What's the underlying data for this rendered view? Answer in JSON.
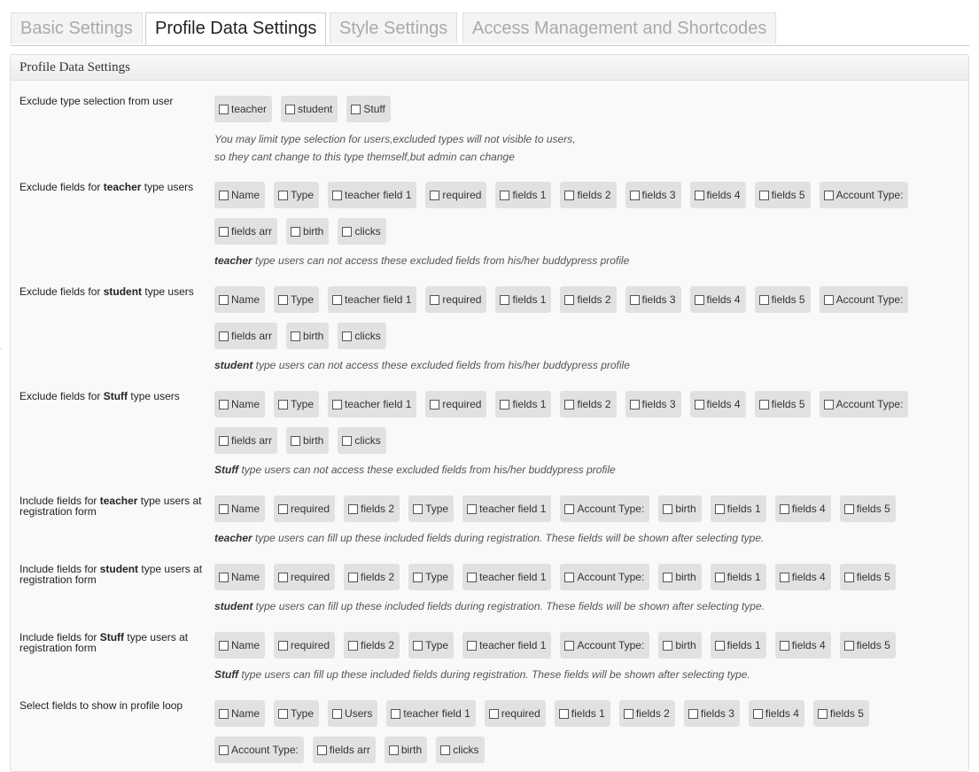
{
  "tabs": [
    {
      "label": "Basic Settings",
      "active": false
    },
    {
      "label": "Profile Data Settings",
      "active": true
    },
    {
      "label": "Style Settings",
      "active": false
    },
    {
      "label": "Access Management and Shortcodes",
      "active": false
    }
  ],
  "panel": {
    "title": "Profile Data Settings"
  },
  "rows": [
    {
      "label": "Exclude type selection from user",
      "options": [
        "teacher",
        "student",
        "Stuff"
      ],
      "desc": [
        "You may limit type selection for users,excluded types will not visible to users,",
        "so they cant change to this type themself,but admin can change"
      ]
    },
    {
      "label_prefix": "Exclude fields for ",
      "label_strong": "teacher",
      "label_suffix": " type users",
      "options": [
        "Name",
        "Type",
        "teacher field 1",
        "required",
        "fields 1",
        "fields 2",
        "fields 3",
        "fields 4",
        "fields 5",
        "Account Type:",
        "fields arr",
        "birth",
        "clicks"
      ],
      "desc_strong": "teacher",
      "desc_text": " type users can not access these excluded fields from his/her buddypress profile"
    },
    {
      "label_prefix": "Exclude fields for ",
      "label_strong": "student",
      "label_suffix": " type users",
      "options": [
        "Name",
        "Type",
        "teacher field 1",
        "required",
        "fields 1",
        "fields 2",
        "fields 3",
        "fields 4",
        "fields 5",
        "Account Type:",
        "fields arr",
        "birth",
        "clicks"
      ],
      "desc_strong": "student",
      "desc_text": " type users can not access these excluded fields from his/her buddypress profile"
    },
    {
      "label_prefix": "Exclude fields for ",
      "label_strong": "Stuff",
      "label_suffix": " type users",
      "options": [
        "Name",
        "Type",
        "teacher field 1",
        "required",
        "fields 1",
        "fields 2",
        "fields 3",
        "fields 4",
        "fields 5",
        "Account Type:",
        "fields arr",
        "birth",
        "clicks"
      ],
      "desc_strong": "Stuff",
      "desc_text": " type users can not access these excluded fields from his/her buddypress profile"
    },
    {
      "label_prefix": "Include fields for ",
      "label_strong": "teacher",
      "label_suffix": " type users at registration form",
      "options": [
        "Name",
        "required",
        "fields 2",
        "Type",
        "teacher field 1",
        "Account Type:",
        "birth",
        "fields 1",
        "fields 4",
        "fields 5"
      ],
      "desc_strong": "teacher",
      "desc_text": " type users can fill up these included fields during registration. These fields will be shown after selecting type."
    },
    {
      "label_prefix": "Include fields for ",
      "label_strong": "student",
      "label_suffix": " type users at registration form",
      "options": [
        "Name",
        "required",
        "fields 2",
        "Type",
        "teacher field 1",
        "Account Type:",
        "birth",
        "fields 1",
        "fields 4",
        "fields 5"
      ],
      "desc_strong": "student",
      "desc_text": " type users can fill up these included fields during registration. These fields will be shown after selecting type."
    },
    {
      "label_prefix": "Include fields for ",
      "label_strong": "Stuff",
      "label_suffix": " type users at registration form",
      "options": [
        "Name",
        "required",
        "fields 2",
        "Type",
        "teacher field 1",
        "Account Type:",
        "birth",
        "fields 1",
        "fields 4",
        "fields 5"
      ],
      "desc_strong": "Stuff",
      "desc_text": " type users can fill up these included fields during registration. These fields will be shown after selecting type."
    },
    {
      "label": "Select fields to show in profile loop",
      "options": [
        "Name",
        "Type",
        "Users",
        "teacher field 1",
        "required",
        "fields 1",
        "fields 2",
        "fields 3",
        "fields 4",
        "fields 5",
        "Account Type:",
        "fields arr",
        "birth",
        "clicks"
      ]
    }
  ]
}
